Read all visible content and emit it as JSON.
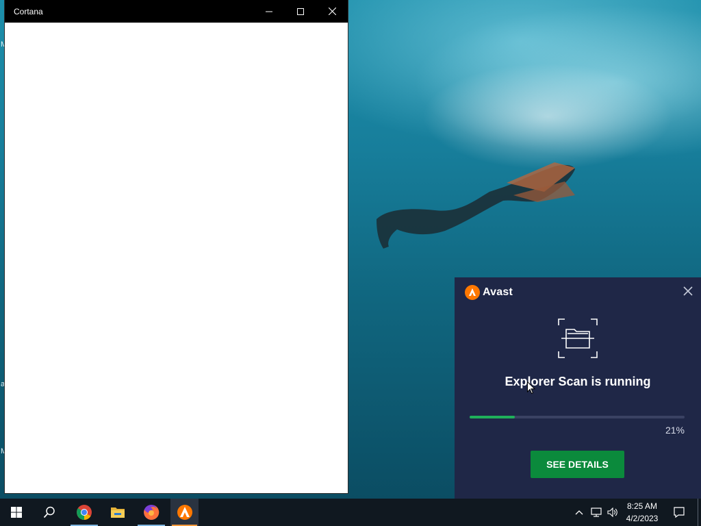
{
  "desktop": {
    "edge_letters": [
      "M",
      "a",
      "M"
    ]
  },
  "cortana_window": {
    "title": "Cortana",
    "minimize_icon": "minimize-icon",
    "maximize_icon": "maximize-icon",
    "close_icon": "close-icon"
  },
  "avast_popup": {
    "brand": "Avast",
    "brand_color": "#ff7800",
    "scan_title": "Explorer Scan is running",
    "progress_percent_text": "21%",
    "progress_value": 0.21,
    "progress_color": "#1fb05a",
    "button_label": "SEE DETAILS",
    "button_color": "#0b8a3c",
    "close_icon": "close-icon"
  },
  "taskbar": {
    "items": [
      {
        "name": "start",
        "icon": "windows-logo-icon"
      },
      {
        "name": "search",
        "icon": "search-icon"
      },
      {
        "name": "chrome",
        "icon": "chrome-icon"
      },
      {
        "name": "file-explorer",
        "icon": "folder-icon"
      },
      {
        "name": "firefox",
        "icon": "firefox-icon"
      },
      {
        "name": "avast",
        "icon": "avast-icon"
      }
    ],
    "tray": {
      "time": "8:25 AM",
      "date": "4/2/2023"
    }
  }
}
